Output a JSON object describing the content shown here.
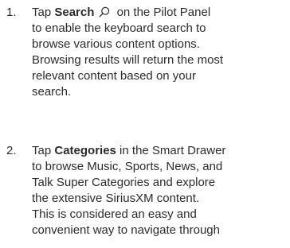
{
  "steps": [
    {
      "number": "1.",
      "lines": [
        {
          "before": "Tap ",
          "bold": "Search",
          "icon": "search-icon",
          "after": " on the Pilot Panel"
        },
        {
          "text": "to enable the keyboard search to"
        },
        {
          "text": "browse various content options."
        },
        {
          "text": "Browsing results will return the most"
        },
        {
          "text": "relevant content based on your"
        },
        {
          "text": "search."
        }
      ]
    },
    {
      "number": "2.",
      "lines": [
        {
          "before": "Tap ",
          "bold": "Categories",
          "after": " in the Smart Drawer"
        },
        {
          "text": "to browse Music, Sports, News, and"
        },
        {
          "text": "Talk Super Categories and explore"
        },
        {
          "text": "the extensive SiriusXM content."
        },
        {
          "text": "This is considered an easy and"
        },
        {
          "text": "convenient way to navigate through"
        }
      ]
    }
  ],
  "colors": {
    "text": "#2b2b2b",
    "background": "#ffffff"
  }
}
